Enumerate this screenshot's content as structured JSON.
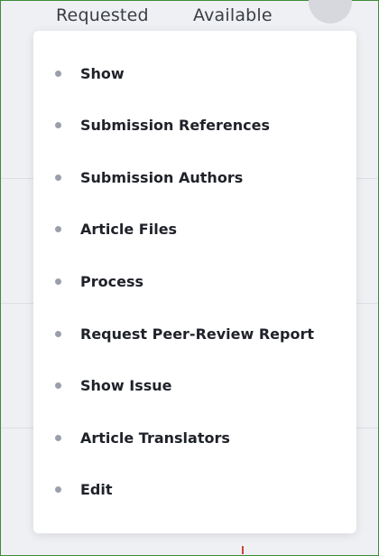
{
  "tabs": {
    "requested": "Requested",
    "available": "Available"
  },
  "more_button": {
    "label": "•••",
    "icon": "more-horizontal-icon"
  },
  "menu": {
    "items": [
      {
        "label": "Show"
      },
      {
        "label": "Submission References"
      },
      {
        "label": "Submission Authors"
      },
      {
        "label": "Article Files"
      },
      {
        "label": "Process"
      },
      {
        "label": "Request Peer-Review Report"
      },
      {
        "label": "Show Issue"
      },
      {
        "label": "Article Translators"
      },
      {
        "label": "Edit"
      }
    ]
  },
  "colors": {
    "frame_border": "#3f8c3a",
    "bullet": "#9aa0ab",
    "menu_text": "#1f2229",
    "menu_bg": "#ffffff"
  }
}
